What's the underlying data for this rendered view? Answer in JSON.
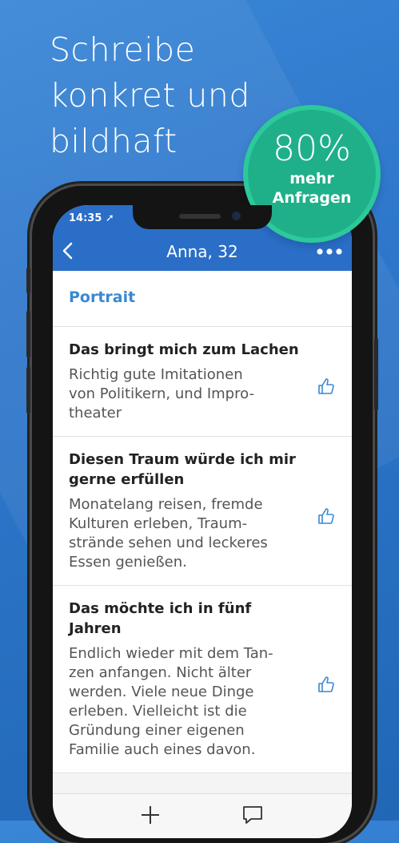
{
  "headline": "Schreibe\nkonkret und\nbildhaft",
  "badge": {
    "percent": "80%",
    "label_line1": "mehr",
    "label_line2": "Anfragen"
  },
  "status": {
    "time": "14:35 ➚"
  },
  "navbar": {
    "title": "Anna, 32",
    "back_icon": "chevron-left-icon",
    "more_icon": "ellipsis-icon"
  },
  "section": {
    "title": "Portrait"
  },
  "cards": [
    {
      "question": "Das bringt mich zum Lachen",
      "answer": "Richtig gute Imitationen\nvon Politikern, und Impro-\ntheater"
    },
    {
      "question": "Diesen Traum würde ich mir gerne erfüllen",
      "answer": "Monatelang reisen, fremde\nKulturen erleben, Traum-\nstrände sehen und leckeres\nEssen genießen."
    },
    {
      "question": "Das möchte ich in fünf Jahren",
      "answer": "Endlich wieder mit dem Tan-\nzen anfangen. Nicht älter\nwerden. Viele neue Dinge\nerleben. Vielleicht ist die\nGründung einer eigenen\nFamilie auch eines davon."
    }
  ],
  "tabbar": {
    "add_icon": "plus-icon",
    "chat_icon": "chat-bubble-icon"
  },
  "colors": {
    "navbar": "#2a6ec7",
    "accent": "#3a88d2",
    "badge": "#1fb08a",
    "background": "#2f78cc"
  }
}
